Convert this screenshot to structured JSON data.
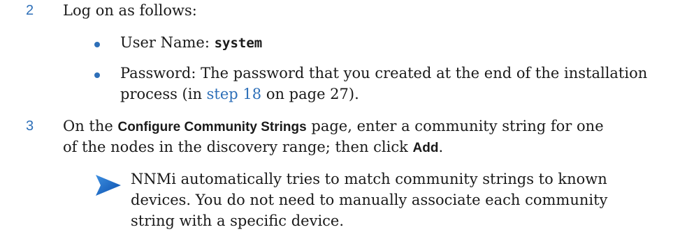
{
  "step2": {
    "number": "2",
    "text": "Log on as follows:",
    "bullet1": {
      "label": "User Name: ",
      "value": "system"
    },
    "bullet2": {
      "line1": "Password: The password that you created at the end of the installation",
      "line2_prefix": "process (in ",
      "link": "step 18",
      "line2_suffix": " on page 27)."
    }
  },
  "step3": {
    "number": "3",
    "line1_prefix": "On the ",
    "page_name": "Configure Community Strings",
    "line1_suffix": " page, enter a community string for one",
    "line2_prefix": "of the nodes in the discovery range; then click ",
    "button_name": "Add",
    "line2_suffix": "."
  },
  "note": {
    "icon": "arrow-note-icon",
    "line1": "NNMi automatically tries to match community strings to known",
    "line2": "devices. You do not need to manually associate each community",
    "line3": "string with a specific device."
  },
  "colors": {
    "accent": "#2d6fb8",
    "text": "#1a1a1a"
  }
}
